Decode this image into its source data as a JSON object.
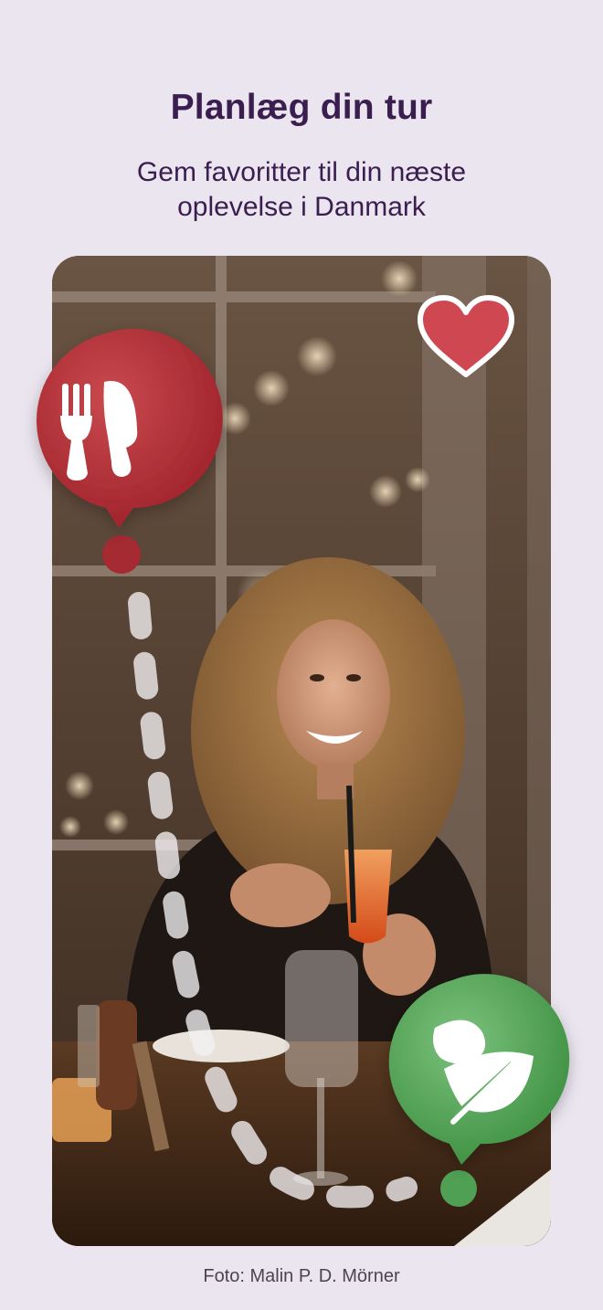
{
  "header": {
    "title": "Planlæg din tur",
    "subtitle_line1": "Gem favoritter til din næste",
    "subtitle_line2": "oplevelse i Danmark"
  },
  "photo": {
    "subject": "woman-laughing-with-drink-at-restaurant-table"
  },
  "caption": "Foto: Malin P. D. Mörner",
  "icons": {
    "favorite": "heart-icon",
    "restaurant_pin": "fork-knife-icon",
    "nature_pin": "leaf-icon"
  },
  "colors": {
    "background": "#ebe5ef",
    "title": "#3a1e4f",
    "red_pin": "#b8303a",
    "green_pin": "#4fa055",
    "heart": "#cf4750"
  }
}
